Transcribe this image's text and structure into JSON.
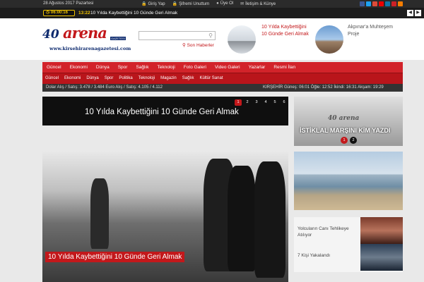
{
  "topbar": {
    "date": "28 Ağustos 2017 Pazartesi",
    "links": [
      {
        "icon": "lock-icon",
        "label": "Giriş Yap"
      },
      {
        "icon": "lock-icon",
        "label": "Şifremi Unuttum"
      },
      {
        "icon": "user-icon",
        "label": "Üye Ol"
      },
      {
        "icon": "envelope-icon",
        "label": "İletişim & Künye"
      }
    ],
    "social_colors": [
      "#3b5998",
      "#1da1f2",
      "#dd4b39",
      "#e00",
      "#0e76a8",
      "#cc2127",
      "#f57d00"
    ]
  },
  "ticker": {
    "clock": "06:00:16",
    "time": "13:22",
    "headline": "10 Yılda Kaybettiğini 10 Günde Geri Almak"
  },
  "header": {
    "logo_number": "40",
    "logo_brand": "arena",
    "logo_tag": "GAZETESİ",
    "logo_site": "www.kirsehirarenagazetesi.com",
    "search_placeholder": "",
    "last_news": "Son Haberler",
    "featured": [
      {
        "title": "10 Yılda Kaybettiğini 10 Günde Geri Almak"
      },
      {
        "title": "Akpınar'a Muhteşem Proje"
      }
    ]
  },
  "nav": {
    "primary": [
      "Güncel",
      "Ekonomi",
      "Dünya",
      "Spor",
      "Sağlık",
      "Teknoloji",
      "Foto Galeri",
      "Video Galeri",
      "Yazarlar",
      "Resmi İlan"
    ],
    "secondary": [
      "Güncel",
      "Ekonomi",
      "Dünya",
      "Spor",
      "Politika",
      "Teknoloji",
      "Magazin",
      "Sağlık",
      "Kültür Sanat"
    ]
  },
  "infobar": {
    "fx": "Dolar Alış / Satış: 3.478 / 3.484   Euro Alış / Satış: 4.105 / 4.112",
    "prayer": "KIRŞEHİR   Güneş: 06:01   Öğle: 12:52   İkindi: 16:31   Akşam: 19:29"
  },
  "slider": {
    "title": "10 Yılda Kaybettiğini 10 Günde Geri Almak",
    "pages": [
      "1",
      "2",
      "3",
      "4",
      "5",
      "6"
    ],
    "active_page": "1",
    "main_caption": "10 Yılda Kaybettiğini 10 Günde Geri Almak"
  },
  "sidebar": {
    "box1_logo": "40 arena",
    "box1_title": "İSTİKLAL MARŞINI KİM YAZDI",
    "box1_pages": [
      "1",
      "2"
    ],
    "items": [
      {
        "title": "Yolcuların Canı Tehlikeye Atılıyor"
      },
      {
        "title": "7 Kişi Yakalandı"
      }
    ]
  },
  "colors": {
    "brand_red": "#c3181b",
    "nav_red": "#d2232a",
    "logo_blue": "#0d2a6e",
    "clock_yellow": "#f2c400"
  }
}
